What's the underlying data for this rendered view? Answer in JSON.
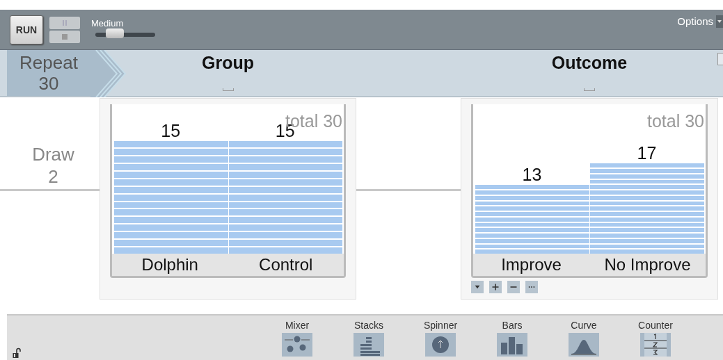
{
  "toolbar": {
    "run_label": "RUN",
    "speed_label": "Medium",
    "speed": {
      "level": 0.32
    },
    "options_label": "Options"
  },
  "repeat": {
    "label": "Repeat",
    "value": "30"
  },
  "draw": {
    "label": "Draw",
    "value": "2"
  },
  "devices": [
    {
      "title": "Group",
      "total": "total 30",
      "show_tools": false,
      "bars": [
        {
          "label": "Dolphin",
          "count": "15"
        },
        {
          "label": "Control",
          "count": "15"
        }
      ]
    },
    {
      "title": "Outcome",
      "total": "total 30",
      "show_tools": true,
      "bars": [
        {
          "label": "Improve",
          "count": "13"
        },
        {
          "label": "No Improve",
          "count": "17"
        }
      ]
    }
  ],
  "palette": [
    "Mixer",
    "Stacks",
    "Spinner",
    "Bars",
    "Curve",
    "Counter"
  ]
}
